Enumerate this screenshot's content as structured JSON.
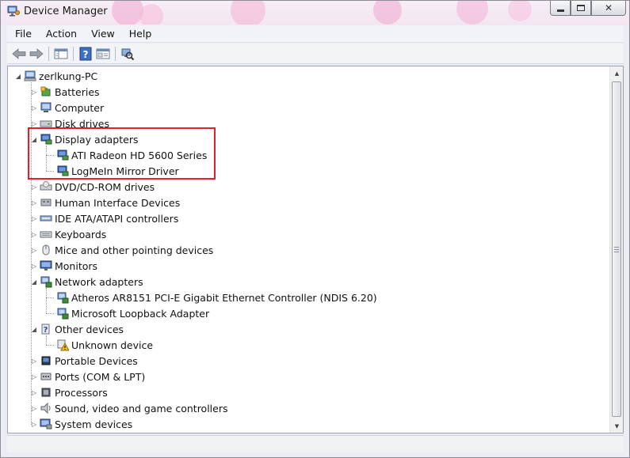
{
  "window": {
    "title": "Device Manager"
  },
  "menu": [
    "File",
    "Action",
    "View",
    "Help"
  ],
  "toolbar": {
    "buttons": [
      {
        "icon": "back-arrow-icon"
      },
      {
        "icon": "forward-arrow-icon"
      },
      {
        "icon": "show-hide-console-tree-icon"
      },
      {
        "icon": "help-icon"
      },
      {
        "icon": "properties-icon"
      },
      {
        "icon": "scan-hardware-changes-icon"
      }
    ]
  },
  "tree": {
    "root": {
      "label": "zerlkung-PC",
      "expanded": true
    },
    "items": [
      {
        "label": "Batteries",
        "icon": "battery-icon",
        "expanded": false,
        "children": []
      },
      {
        "label": "Computer",
        "icon": "computer-icon",
        "expanded": false,
        "children": []
      },
      {
        "label": "Disk drives",
        "icon": "disk-drive-icon",
        "expanded": false,
        "children": []
      },
      {
        "label": "Display adapters",
        "icon": "display-adapter-icon",
        "expanded": true,
        "children": [
          {
            "label": "ATI Radeon HD 5600 Series",
            "icon": "display-adapter-icon"
          },
          {
            "label": "LogMeIn Mirror Driver",
            "icon": "display-adapter-icon"
          }
        ]
      },
      {
        "label": "DVD/CD-ROM drives",
        "icon": "dvd-drive-icon",
        "expanded": false,
        "children": []
      },
      {
        "label": "Human Interface Devices",
        "icon": "hid-icon",
        "expanded": false,
        "children": []
      },
      {
        "label": "IDE ATA/ATAPI controllers",
        "icon": "ide-controller-icon",
        "expanded": false,
        "children": []
      },
      {
        "label": "Keyboards",
        "icon": "keyboard-icon",
        "expanded": false,
        "children": []
      },
      {
        "label": "Mice and other pointing devices",
        "icon": "mouse-icon",
        "expanded": false,
        "children": []
      },
      {
        "label": "Monitors",
        "icon": "monitor-icon",
        "expanded": false,
        "children": []
      },
      {
        "label": "Network adapters",
        "icon": "network-adapter-icon",
        "expanded": true,
        "children": [
          {
            "label": "Atheros AR8151 PCI-E Gigabit Ethernet Controller (NDIS 6.20)",
            "icon": "network-adapter-icon"
          },
          {
            "label": "Microsoft Loopback Adapter",
            "icon": "network-adapter-icon"
          }
        ]
      },
      {
        "label": "Other devices",
        "icon": "other-devices-icon",
        "expanded": true,
        "children": [
          {
            "label": "Unknown device",
            "icon": "unknown-device-warning-icon"
          }
        ]
      },
      {
        "label": "Portable Devices",
        "icon": "portable-device-icon",
        "expanded": false,
        "children": []
      },
      {
        "label": "Ports (COM & LPT)",
        "icon": "port-icon",
        "expanded": false,
        "children": []
      },
      {
        "label": "Processors",
        "icon": "processor-icon",
        "expanded": false,
        "children": []
      },
      {
        "label": "Sound, video and game controllers",
        "icon": "sound-icon",
        "expanded": false,
        "children": []
      },
      {
        "label": "System devices",
        "icon": "system-devices-icon",
        "expanded": false,
        "children": []
      }
    ]
  },
  "colors": {
    "highlight": "#e01f2a",
    "title_bg": "#f6eef6",
    "pane_bg": "#ffffff"
  }
}
